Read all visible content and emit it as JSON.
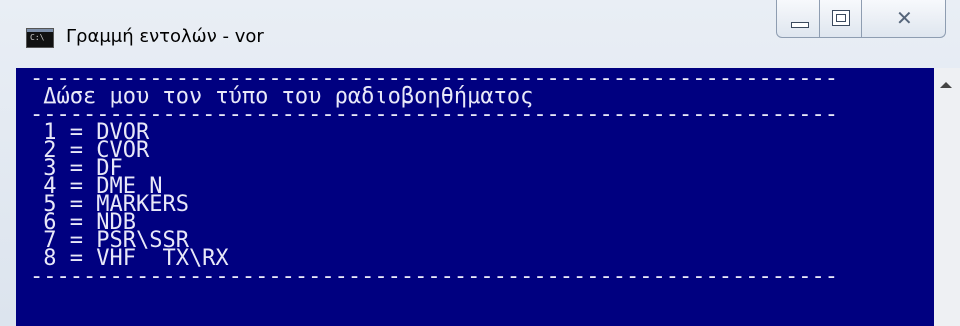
{
  "window": {
    "title": "Γραμμή εντολών - vor",
    "icon": "cmd-icon",
    "icon_text": "C:\\"
  },
  "caption_buttons": {
    "minimize": "minimize-icon",
    "maximize": "maximize-icon",
    "close": "close-icon"
  },
  "console": {
    "background": "#000080",
    "foreground": "#e8e8f8",
    "separator": "-------------------------------------------------------------",
    "prompt": " Δώσε μου τον τύπο του ραδιοβοηθήματος",
    "options": [
      " 1 = DVOR",
      " 2 = CVOR",
      " 3 = DF",
      " 4 = DME N",
      " 5 = MARKERS",
      " 6 = NDB",
      " 7 = PSR\\SSR",
      " 8 = VHF  TX\\RX"
    ]
  }
}
